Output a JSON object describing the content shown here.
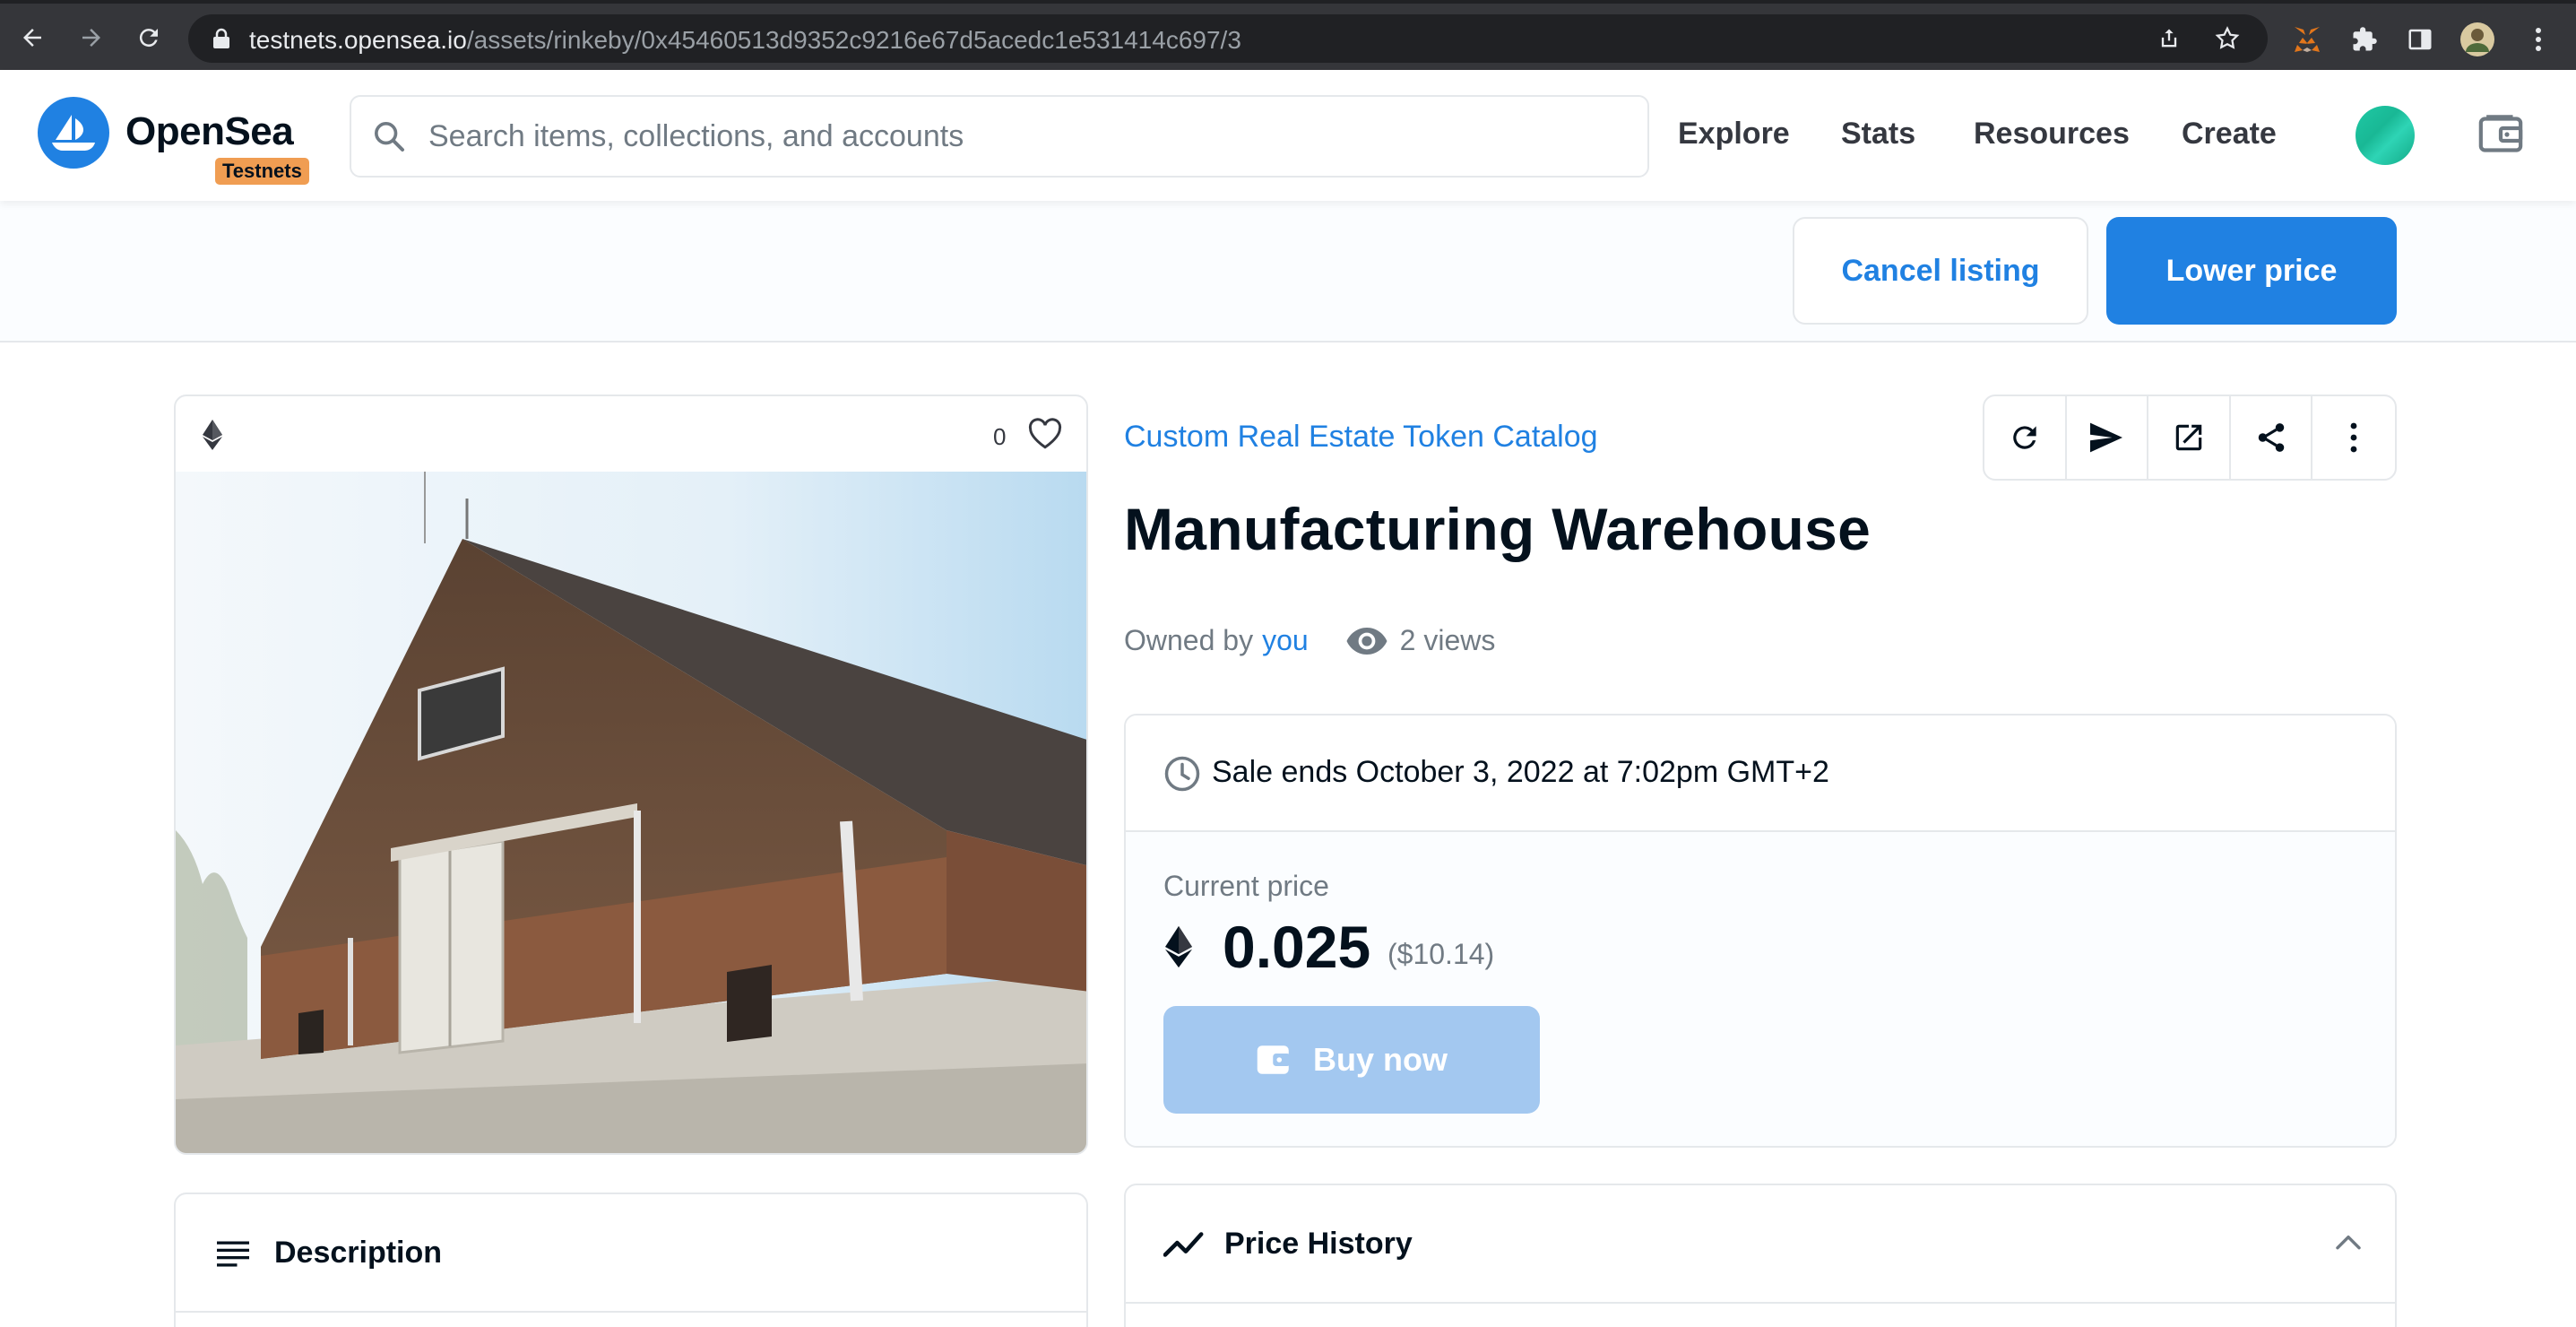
{
  "browser": {
    "url_host": "testnets.opensea.io",
    "url_path": "/assets/rinkeby/0x45460513d9352c9216e67d5acedc1e531414c697/3"
  },
  "header": {
    "logo_text": "OpenSea",
    "badge": "Testnets",
    "search_placeholder": "Search items, collections, and accounts",
    "nav": [
      "Explore",
      "Stats",
      "Resources",
      "Create"
    ]
  },
  "owner_actions": {
    "cancel_label": "Cancel listing",
    "lower_label": "Lower price"
  },
  "asset": {
    "favorites": "0",
    "collection": "Custom Real Estate Token Catalog",
    "title": "Manufacturing Warehouse",
    "owned_by_label": "Owned by",
    "owner": "you",
    "views": "2 views"
  },
  "sale": {
    "ends": "Sale ends October 3, 2022 at 7:02pm GMT+2",
    "price_label": "Current price",
    "price": "0.025",
    "price_usd": "($10.14)",
    "buy_label": "Buy now"
  },
  "sections": {
    "description": "Description",
    "price_history": "Price History"
  },
  "colors": {
    "accent": "#2081e2",
    "badge": "#f09d52",
    "disabled_button": "#a3c8f0"
  }
}
